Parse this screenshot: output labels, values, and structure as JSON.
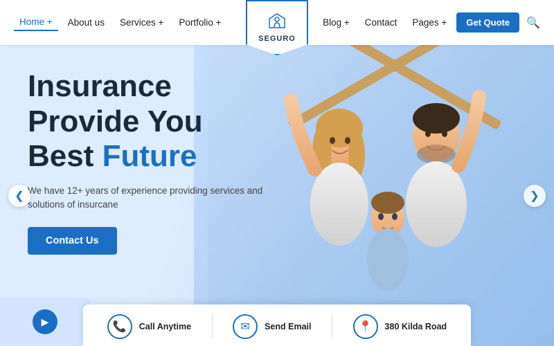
{
  "navbar": {
    "logo_text": "SEGURO",
    "nav_left": [
      {
        "label": "Home +",
        "active": true
      },
      {
        "label": "About us",
        "active": false
      },
      {
        "label": "Services +",
        "active": false
      },
      {
        "label": "Portfolio +",
        "active": false
      }
    ],
    "nav_right": [
      {
        "label": "Blog +",
        "active": false
      },
      {
        "label": "Contact",
        "active": false
      },
      {
        "label": "Pages +",
        "active": false
      }
    ],
    "get_quote_label": "Get Quote"
  },
  "hero": {
    "title_line1": "Insurance",
    "title_line2": "Provide You",
    "title_line3_normal": "Best ",
    "title_line3_highlight": "Future",
    "subtitle": "We have 12+ years of experience providing services and solutions of insurcane",
    "cta_label": "Contact Us"
  },
  "arrows": {
    "prev": "❮",
    "next": "❯"
  },
  "info_bar": {
    "items": [
      {
        "icon": "📞",
        "label": "Call Anytime"
      },
      {
        "icon": "✉",
        "label": "Send Email"
      },
      {
        "icon": "📍",
        "label": "380 Kilda Road"
      }
    ]
  },
  "colors": {
    "primary": "#1a6fc4",
    "dark": "#1a2a3a",
    "light_bg": "#e8f1fb"
  }
}
